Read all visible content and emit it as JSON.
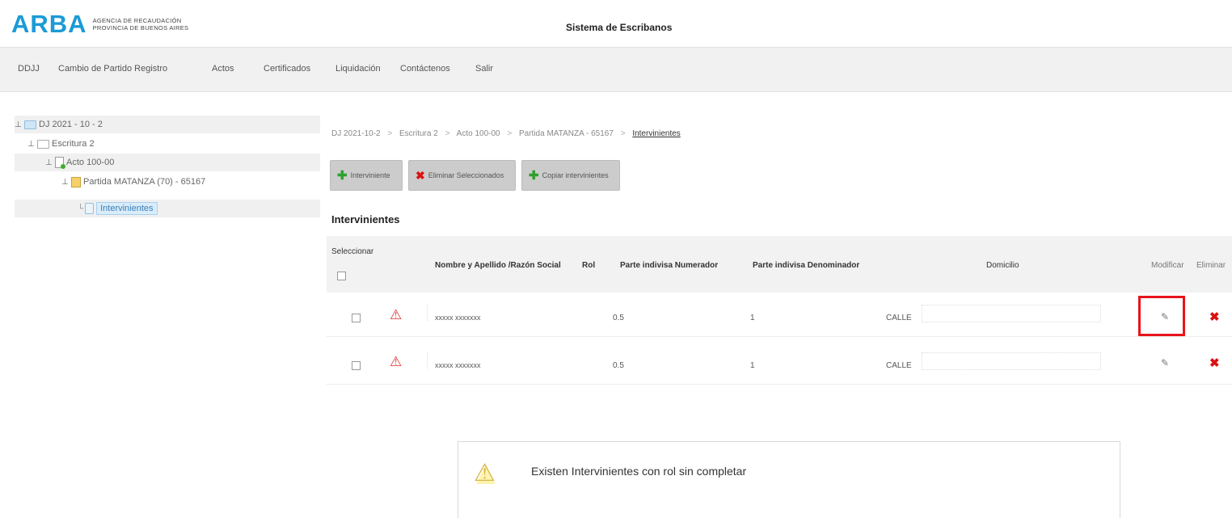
{
  "header": {
    "logo": "ARBA",
    "logo_sub_line1": "AGENCIA DE RECAUDACIÓN",
    "logo_sub_line2": "PROVINCIA DE BUENOS AIRES",
    "system_title": "Sistema de Escribanos"
  },
  "nav": {
    "items": [
      "DDJJ",
      "Cambio de Partido Registro",
      "Actos",
      "Certificados",
      "Liquidación",
      "Contáctenos",
      "Salir"
    ]
  },
  "tree": {
    "nodes": [
      {
        "label": "DJ 2021 - 10 - 2",
        "icon": "folder-icon"
      },
      {
        "label": "Escritura 2",
        "icon": "folder-open-icon"
      },
      {
        "label": "Acto 100-00",
        "icon": "document-icon"
      },
      {
        "label": "Partida MATANZA (70) - 65167",
        "icon": "lot-icon"
      },
      {
        "label": "Intervinientes",
        "icon": "person-icon"
      }
    ]
  },
  "breadcrumb": {
    "items": [
      "DJ 2021-10-2",
      "Escritura 2",
      "Acto 100-00",
      "Partida MATANZA - 65167",
      "Intervinientes"
    ],
    "separator": ">"
  },
  "toolbar": {
    "add_label": "Interviniente",
    "delete_label": "Eliminar Seleccionados",
    "copy_label": "Copiar intervinientes"
  },
  "section_title": "Intervinientes",
  "table": {
    "headers": {
      "select": "Seleccionar",
      "name": "Nombre y Apellido /Razón Social",
      "rol": "Rol",
      "num": "Parte indivisa Numerador",
      "den": "Parte indivisa Denominador",
      "dom": "Domicilio",
      "mod": "Modificar",
      "del": "Eliminar"
    },
    "rows": [
      {
        "name": "xxxxx xxxxxxx",
        "rol": "",
        "num": "0.5",
        "den": "1",
        "dom": "CALLE"
      },
      {
        "name": "xxxxx xxxxxxx",
        "rol": "",
        "num": "0.5",
        "den": "1",
        "dom": "CALLE"
      }
    ]
  },
  "alert": {
    "message": "Existen Intervinientes con rol sin completar",
    "icon": "warning-icon"
  },
  "colors": {
    "brand": "#1b9ad6",
    "highlight": "#e8141c",
    "delete": "#dd1111",
    "add": "#2fa02f"
  }
}
